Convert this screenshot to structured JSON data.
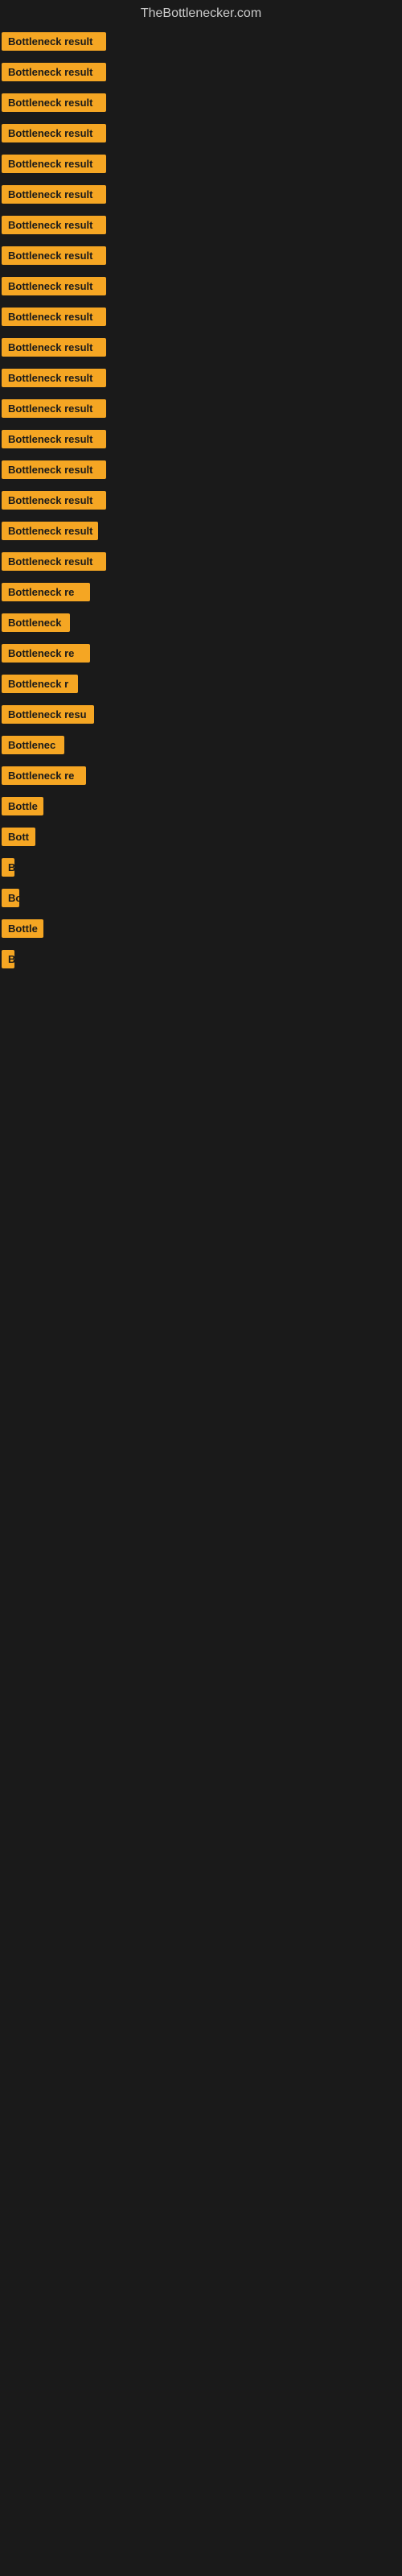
{
  "site": {
    "title": "TheBottlenecker.com"
  },
  "items": [
    {
      "id": 1,
      "label": "Bottleneck result",
      "width": 130
    },
    {
      "id": 2,
      "label": "Bottleneck result",
      "width": 130
    },
    {
      "id": 3,
      "label": "Bottleneck result",
      "width": 130
    },
    {
      "id": 4,
      "label": "Bottleneck result",
      "width": 130
    },
    {
      "id": 5,
      "label": "Bottleneck result",
      "width": 130
    },
    {
      "id": 6,
      "label": "Bottleneck result",
      "width": 130
    },
    {
      "id": 7,
      "label": "Bottleneck result",
      "width": 130
    },
    {
      "id": 8,
      "label": "Bottleneck result",
      "width": 130
    },
    {
      "id": 9,
      "label": "Bottleneck result",
      "width": 130
    },
    {
      "id": 10,
      "label": "Bottleneck result",
      "width": 130
    },
    {
      "id": 11,
      "label": "Bottleneck result",
      "width": 130
    },
    {
      "id": 12,
      "label": "Bottleneck result",
      "width": 130
    },
    {
      "id": 13,
      "label": "Bottleneck result",
      "width": 130
    },
    {
      "id": 14,
      "label": "Bottleneck result",
      "width": 130
    },
    {
      "id": 15,
      "label": "Bottleneck result",
      "width": 130
    },
    {
      "id": 16,
      "label": "Bottleneck result",
      "width": 130
    },
    {
      "id": 17,
      "label": "Bottleneck result",
      "width": 120
    },
    {
      "id": 18,
      "label": "Bottleneck result",
      "width": 130
    },
    {
      "id": 19,
      "label": "Bottleneck re",
      "width": 110
    },
    {
      "id": 20,
      "label": "Bottleneck",
      "width": 85
    },
    {
      "id": 21,
      "label": "Bottleneck re",
      "width": 110
    },
    {
      "id": 22,
      "label": "Bottleneck r",
      "width": 95
    },
    {
      "id": 23,
      "label": "Bottleneck resu",
      "width": 115
    },
    {
      "id": 24,
      "label": "Bottlenec",
      "width": 78
    },
    {
      "id": 25,
      "label": "Bottleneck re",
      "width": 105
    },
    {
      "id": 26,
      "label": "Bottle",
      "width": 52
    },
    {
      "id": 27,
      "label": "Bott",
      "width": 42
    },
    {
      "id": 28,
      "label": "B",
      "width": 16
    },
    {
      "id": 29,
      "label": "Bo",
      "width": 22
    },
    {
      "id": 30,
      "label": "Bottle",
      "width": 52
    },
    {
      "id": 31,
      "label": "B",
      "width": 14
    }
  ]
}
